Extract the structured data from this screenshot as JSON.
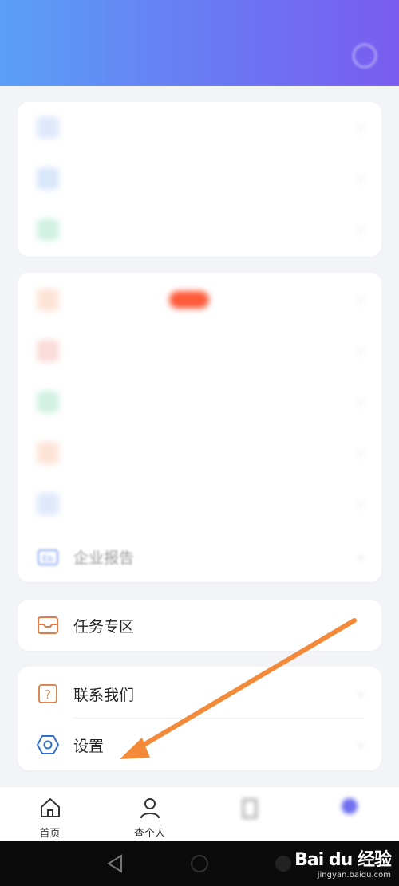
{
  "header": {
    "title": "",
    "status_left": "",
    "status_right": ""
  },
  "colors": {
    "accent_blue": "#5aa0f7",
    "accent_purple": "#7a5cf0",
    "arrow": "#f28a3a"
  },
  "card1": {
    "items": [
      {
        "label": "",
        "icon": "document-icon",
        "color": "#8fb2f2"
      },
      {
        "label": "",
        "icon": "file-icon",
        "color": "#7fb0f0"
      },
      {
        "label": "",
        "icon": "shield-icon",
        "color": "#4fc69a"
      }
    ]
  },
  "card2": {
    "items": [
      {
        "label": "",
        "icon": "mail-icon",
        "color": "#f5a07a",
        "badge": ""
      },
      {
        "label": "",
        "icon": "calendar-icon",
        "color": "#f08a8a"
      },
      {
        "label": "",
        "icon": "shop-icon",
        "color": "#4fc69a"
      },
      {
        "label": "",
        "icon": "gift-icon",
        "color": "#f5a07a"
      },
      {
        "label": "",
        "icon": "id-card-icon",
        "color": "#8fb2f2"
      },
      {
        "label": "企业报告",
        "icon": "report-icon",
        "color": "#7a9ef0"
      }
    ]
  },
  "card3": {
    "items": [
      {
        "label": "任务专区",
        "icon": "inbox-icon",
        "color": "#e07a4a"
      }
    ]
  },
  "card4": {
    "items": [
      {
        "label": "联系我们",
        "icon": "question-icon",
        "color": "#d88a55"
      },
      {
        "label": "设置",
        "icon": "hexagon-settings-icon",
        "color": "#2f6fc4"
      }
    ]
  },
  "nav": {
    "tabs": [
      {
        "label": "首页",
        "icon": "home-icon"
      },
      {
        "label": "查个人",
        "icon": "person-icon"
      },
      {
        "label": "",
        "icon": "building-icon"
      },
      {
        "label": "",
        "icon": "profile-icon"
      }
    ]
  },
  "watermark": {
    "logo": "Bai du 经验",
    "url": "jingyan.baidu.com"
  }
}
